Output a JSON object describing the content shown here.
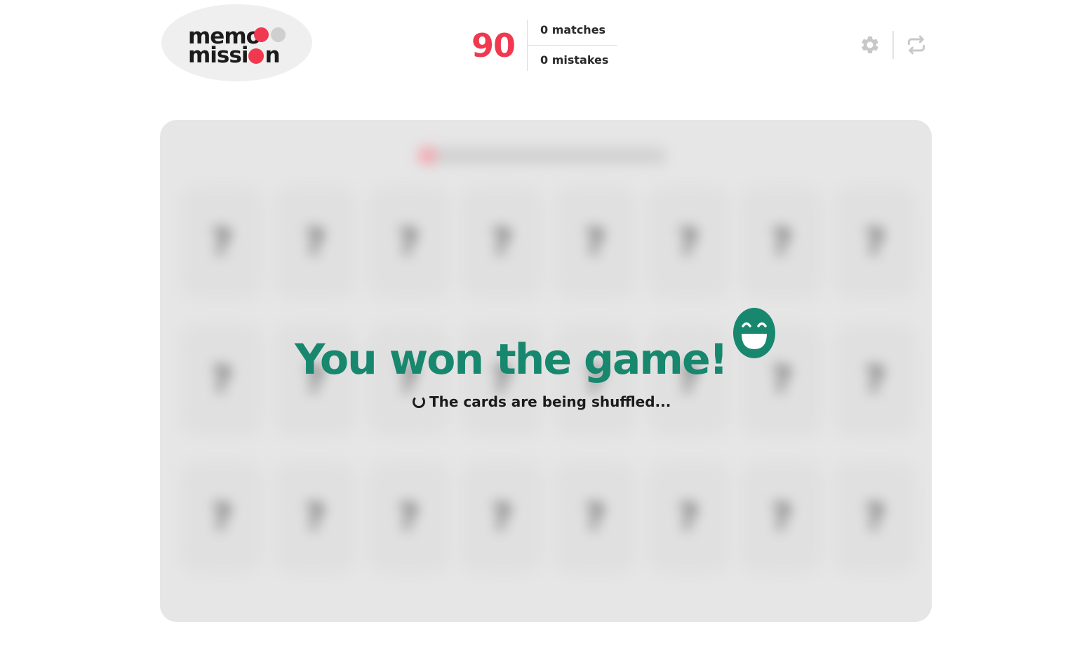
{
  "brand": {
    "logo_line1": "memo",
    "logo_line2": "missi",
    "logo_line2_end": "n",
    "colors": {
      "logo_bg": "#efefef",
      "dot_red": "#f0384f",
      "dot_gray": "#cfcfcf"
    }
  },
  "stats": {
    "score": "90",
    "matches": "0 matches",
    "mistakes": "0 mistakes",
    "score_color": "#f0384f"
  },
  "toolbar": {
    "settings_icon": "gear-icon",
    "shuffle_icon": "shuffle-icon",
    "icon_color": "#c8c8c8"
  },
  "board": {
    "card_glyph": "?",
    "card_count": 24,
    "overlay": {
      "title": "You won the game!",
      "status": "The cards are being shuffled...",
      "emoji_icon": "grinning-face-icon",
      "title_color": "#17876e"
    }
  }
}
